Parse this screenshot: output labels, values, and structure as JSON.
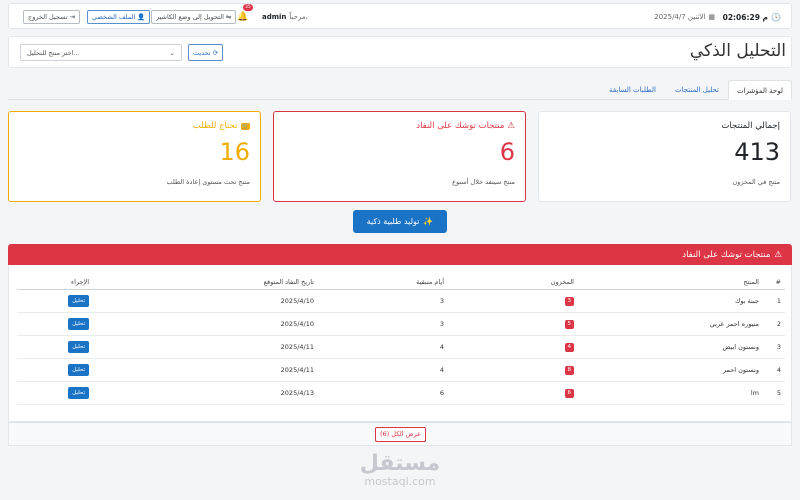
{
  "topbar": {
    "time": "02:06:29 م",
    "date": "الاثنين 2025/4/7",
    "greeting": "مرحباً،",
    "username": "admin",
    "notif_count": "35",
    "cashier_button": "التحويل إلى وضع الكاشير",
    "profile_button": "الملف الشخصي",
    "logout_button": "تسجيل الخروج"
  },
  "header": {
    "title": "التحليل الذكي",
    "select_placeholder": "اختر منتج للتحليل...",
    "refresh_button": "تحديث"
  },
  "tabs": [
    {
      "label": "لوحة المؤشرات",
      "active": true
    },
    {
      "label": "تحليل المنتجات",
      "active": false
    },
    {
      "label": "الطلبات السابقة",
      "active": false
    }
  ],
  "stats": {
    "total": {
      "label": "إجمالي المنتجات",
      "value": "413",
      "sub": "منتج في المخزون"
    },
    "expiring": {
      "label": "منتجات توشك على النفاد",
      "value": "6",
      "sub": "منتج سينفد خلال أسبوع",
      "color": "#dc3545"
    },
    "reorder": {
      "label": "تحتاج للطلب",
      "value": "16",
      "sub": "منتج تحت مستوى إعادة الطلب",
      "color": "#f0ad00"
    }
  },
  "generate_button": "توليد طلبية ذكية",
  "panel": {
    "title": "منتجات توشك على النفاد",
    "columns": [
      "#",
      "المنتج",
      "المخزون",
      "أيام متبقية",
      "تاريخ النفاد المتوقع",
      "الإجراء"
    ],
    "action_label": "تحليل",
    "show_all": "عرض الكل (6)",
    "rows": [
      {
        "num": "1",
        "product": "جبنة بوك",
        "stock": "3",
        "days": "3",
        "date": "2025/4/10"
      },
      {
        "num": "2",
        "product": "منيوره احمر عربي",
        "stock": "5",
        "days": "3",
        "date": "2025/4/10"
      },
      {
        "num": "3",
        "product": "ونستون ابيض",
        "stock": "4",
        "days": "4",
        "date": "2025/4/11"
      },
      {
        "num": "4",
        "product": "ونستون احمر",
        "stock": "8",
        "days": "4",
        "date": "2025/4/11"
      },
      {
        "num": "5",
        "product": "lm",
        "stock": "6",
        "days": "6",
        "date": "2025/4/13"
      }
    ]
  },
  "watermark": {
    "ar": "مستقل",
    "en": "mostaql.com"
  }
}
